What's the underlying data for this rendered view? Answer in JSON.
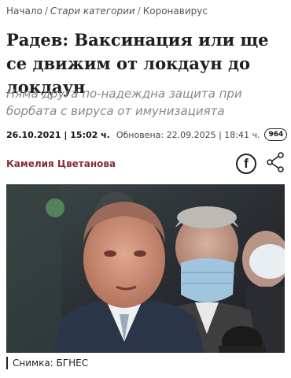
{
  "breadcrumb": {
    "items": [
      "Начало",
      "Стари категории",
      "Коронавирус"
    ],
    "separator": "/"
  },
  "article": {
    "title": "Радев: Ваксинация или ще се движим от локдаун до локдаун",
    "subtitle": "Няма друга по-надеждна защита при борбата с вируса от имунизацията",
    "published": "26.10.2021 | 15:02 ч.",
    "updated": "Обновена: 22.09.2025 | 18:41 ч.",
    "views": "964",
    "author": "Камелия Цветанова"
  },
  "share": {
    "facebook_icon": "facebook-icon",
    "share_icon": "share-icon"
  },
  "photo": {
    "caption": "Снимка: БГНЕС"
  },
  "colors": {
    "author": "#8a2b3b",
    "subtitle": "#888888",
    "title": "#1e1e1e"
  }
}
